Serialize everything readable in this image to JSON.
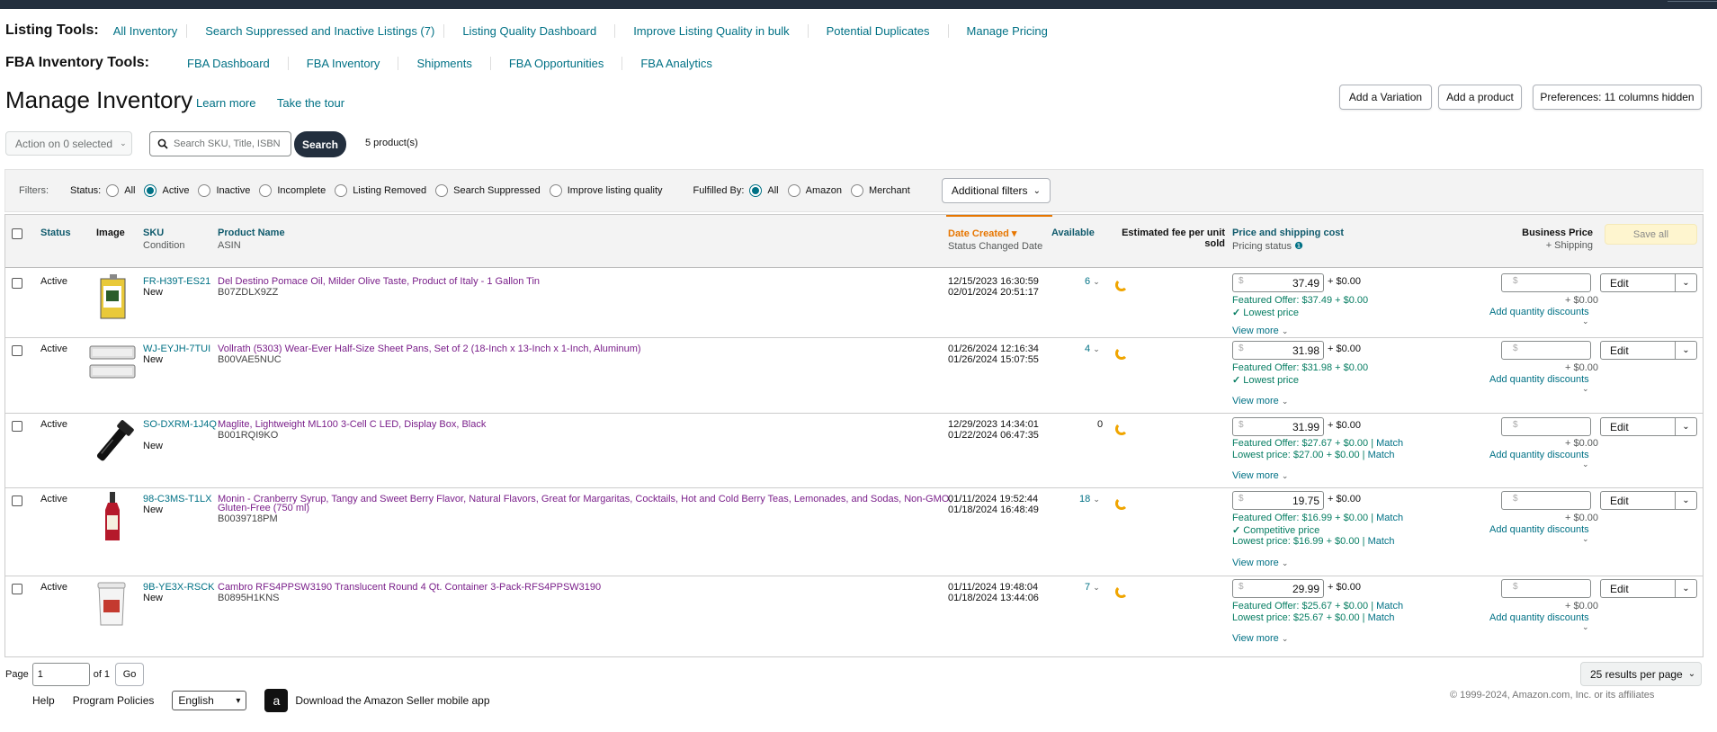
{
  "listing_tools": {
    "title": "Listing Tools:",
    "links": [
      "All Inventory",
      "Search Suppressed and Inactive Listings (7)",
      "Listing Quality Dashboard",
      "Improve Listing Quality in bulk",
      "Potential Duplicates",
      "Manage Pricing"
    ]
  },
  "fba_tools": {
    "title": "FBA Inventory Tools:",
    "links": [
      "FBA Dashboard",
      "FBA Inventory",
      "Shipments",
      "FBA Opportunities",
      "FBA Analytics"
    ]
  },
  "page": {
    "title": "Manage Inventory",
    "learn_more": "Learn more",
    "take_tour": "Take the tour",
    "add_variation": "Add a Variation",
    "add_product": "Add a product",
    "preferences": "Preferences: 11 columns hidden"
  },
  "toolbar": {
    "action": "Action on 0 selected",
    "search_placeholder": "Search SKU, Title, ISBN",
    "search_button": "Search",
    "product_count": "5 product(s)"
  },
  "filters": {
    "label": "Filters:",
    "status_label": "Status:",
    "status_options": [
      "All",
      "Active",
      "Inactive",
      "Incomplete",
      "Listing Removed",
      "Search Suppressed",
      "Improve listing quality"
    ],
    "status_selected": "Active",
    "fulfilled_label": "Fulfilled By:",
    "fulfilled_options": [
      "All",
      "Amazon",
      "Merchant"
    ],
    "fulfilled_selected": "All",
    "additional": "Additional filters"
  },
  "columns": {
    "status": "Status",
    "image": "Image",
    "sku": "SKU",
    "sku_sub": "Condition",
    "product_name": "Product Name",
    "product_sub": "ASIN",
    "date_created": "Date Created",
    "date_sub": "Status Changed Date",
    "available": "Available",
    "fee_line1": "Estimated fee per unit",
    "fee_line2": "sold",
    "price": "Price and shipping cost",
    "price_sub": "Pricing status",
    "business_price": "Business Price",
    "business_sub": "+ Shipping",
    "save_all": "Save all"
  },
  "colors": {
    "accent": "#007185",
    "product_link": "#7a1f8a",
    "sort_active": "#e77600",
    "header_bg": "#f3f3f3",
    "search_button": "#232f3e"
  },
  "rows": [
    {
      "status": "Active",
      "sku": "FR-H39T-ES21",
      "condition": "New",
      "name": "Del Destino Pomace Oil, Milder Olive Taste, Product of Italy - 1 Gallon Tin",
      "asin": "B07ZDLX9ZZ",
      "created": "12/15/2023 16:30:59",
      "changed": "02/01/2024 20:51:17",
      "available": "6",
      "price": "37.49",
      "shipping": "+ $0.00",
      "line1": "Featured Offer: $37.49 + $0.00",
      "line1_match": "",
      "line2": "Lowest price",
      "line2_match": "",
      "line3": "",
      "line3_match": "",
      "image": "olive-oil-tin-image"
    },
    {
      "status": "Active",
      "sku": "WJ-EYJH-7TUI",
      "condition": "New",
      "name": "Vollrath (5303) Wear-Ever Half-Size Sheet Pans, Set of 2 (18-Inch x 13-Inch x 1-Inch, Aluminum)",
      "asin": "B00VAE5NUC",
      "created": "01/26/2024 12:16:34",
      "changed": "01/26/2024 15:07:55",
      "available": "4",
      "price": "31.98",
      "shipping": "+ $0.00",
      "line1": "Featured Offer: $31.98 + $0.00",
      "line1_match": "",
      "line2": "Lowest price",
      "line2_match": "",
      "line3": "",
      "line3_match": "",
      "image": "sheet-pans-image"
    },
    {
      "status": "Active",
      "sku": "SO-DXRM-1J4Q",
      "condition": "New",
      "name": "Maglite, Lightweight ML100 3-Cell C LED, Display Box, Black",
      "asin": "B001RQI9KO",
      "created": "12/29/2023 14:34:01",
      "changed": "01/22/2024 06:47:35",
      "available": "0",
      "price": "31.99",
      "shipping": "+ $0.00",
      "line1": "Featured Offer: $27.67 + $0.00 |",
      "line1_match": "Match",
      "line2": "Lowest price: $27.00 + $0.00 |",
      "line2_match": "Match",
      "line3": "",
      "line3_match": "",
      "image": "flashlight-image"
    },
    {
      "status": "Active",
      "sku": "98-C3MS-T1LX",
      "condition": "New",
      "name": "Monin - Cranberry Syrup, Tangy and Sweet Berry Flavor, Natural Flavors, Great for Margaritas, Cocktails, Hot and Cold Berry Teas, Lemonades, and Sodas, Non-GMO,",
      "name2": "Gluten-Free (750 ml)",
      "asin": "B0039718PM",
      "created": "01/11/2024 19:52:44",
      "changed": "01/18/2024 16:48:49",
      "available": "18",
      "price": "19.75",
      "shipping": "+ $0.00",
      "line1": "Featured Offer: $16.99 + $0.00 |",
      "line1_match": "Match",
      "line2": "Competitive price",
      "line2_match": "",
      "line3": "Lowest price: $16.99 + $0.00 |",
      "line3_match": "Match",
      "image": "syrup-bottle-image"
    },
    {
      "status": "Active",
      "sku": "9B-YE3X-RSCK",
      "condition": "New",
      "name": "Cambro RFS4PPSW3190 Translucent Round 4 Qt. Container 3-Pack-RFS4PPSW3190",
      "asin": "B0895H1KNS",
      "created": "01/11/2024 19:48:04",
      "changed": "01/18/2024 13:44:06",
      "available": "7",
      "price": "29.99",
      "shipping": "+ $0.00",
      "line1": "Featured Offer: $25.67 + $0.00 |",
      "line1_match": "Match",
      "line2": "Lowest price: $25.67 + $0.00 |",
      "line2_match": "Match",
      "line3": "",
      "line3_match": "",
      "image": "container-image"
    }
  ],
  "row_common": {
    "dollar": "$",
    "bp_shipping": "+ $0.00",
    "qty_discounts": "Add quantity discounts",
    "view_more": "View more",
    "edit": "Edit"
  },
  "pagination": {
    "page_label": "Page",
    "page_value": "1",
    "of_label": "of 1",
    "go": "Go",
    "per_page": "25 results per page"
  },
  "footer": {
    "help": "Help",
    "policies": "Program Policies",
    "language": "English",
    "app_text": "Download the Amazon Seller mobile app",
    "copyright": "© 1999-2024, Amazon.com, Inc. or its affiliates"
  }
}
